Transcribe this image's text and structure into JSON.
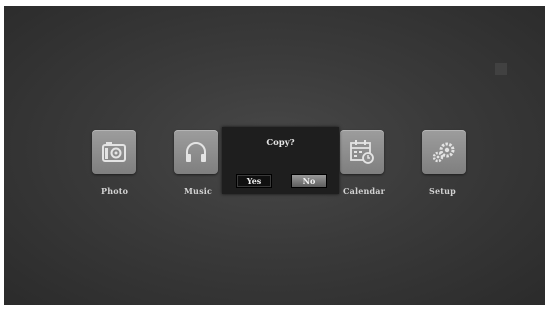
{
  "menu": {
    "items": [
      {
        "label": "Photo",
        "icon": "camera-icon"
      },
      {
        "label": "Music",
        "icon": "headphones-icon"
      },
      {
        "label": "Calendar",
        "icon": "calendar-icon"
      },
      {
        "label": "Setup",
        "icon": "gears-icon"
      }
    ]
  },
  "dialog": {
    "title": "Copy?",
    "yes_label": "Yes",
    "no_label": "No",
    "selected": "Yes"
  },
  "colors": {
    "background": "#3a3a3a",
    "tile": "#8f8f8f",
    "dialog": "#1e1e1e",
    "label": "#d2d2d2"
  }
}
